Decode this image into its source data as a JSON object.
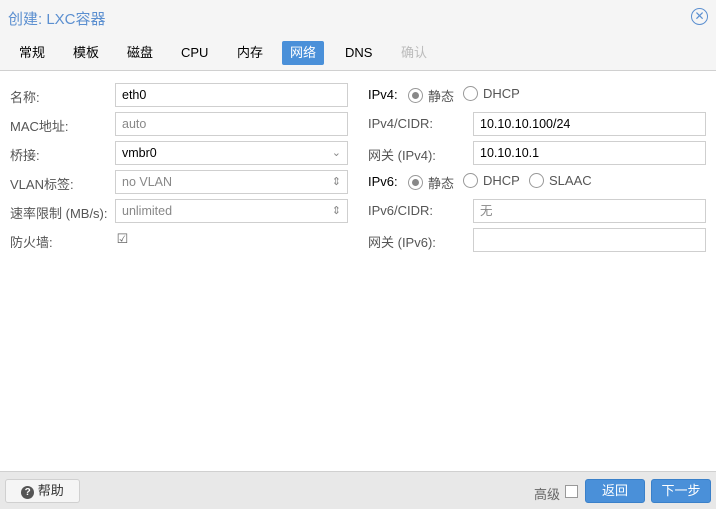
{
  "title": "创建: LXC容器",
  "tabs": [
    "常规",
    "模板",
    "磁盘",
    "CPU",
    "内存",
    "网络",
    "DNS",
    "确认"
  ],
  "left": {
    "name_label": "名称:",
    "name": "eth0",
    "mac_label": "MAC地址:",
    "mac": "auto",
    "bridge_label": "桥接:",
    "bridge": "vmbr0",
    "vlan_label": "VLAN标签:",
    "vlan": "no VLAN",
    "rate_label": "速率限制 (MB/s):",
    "rate": "unlimited",
    "firewall_label": "防火墙:",
    "firewall_checked": true
  },
  "right": {
    "ipv4_label": "IPv4:",
    "ipv4_opts": [
      "静态",
      "DHCP"
    ],
    "ipv4cidr_label": "IPv4/CIDR:",
    "ipv4cidr": "10.10.10.100/24",
    "gw4_label": "网关 (IPv4):",
    "gw4": "10.10.10.1",
    "ipv6_label": "IPv6:",
    "ipv6_opts": [
      "静态",
      "DHCP",
      "SLAAC"
    ],
    "ipv6cidr_label": "IPv6/CIDR:",
    "ipv6cidr": "无",
    "gw6_label": "网关 (IPv6):",
    "gw6": ""
  },
  "footer": {
    "help": "帮助",
    "advanced": "高级",
    "back": "返回",
    "next": "下一步"
  }
}
